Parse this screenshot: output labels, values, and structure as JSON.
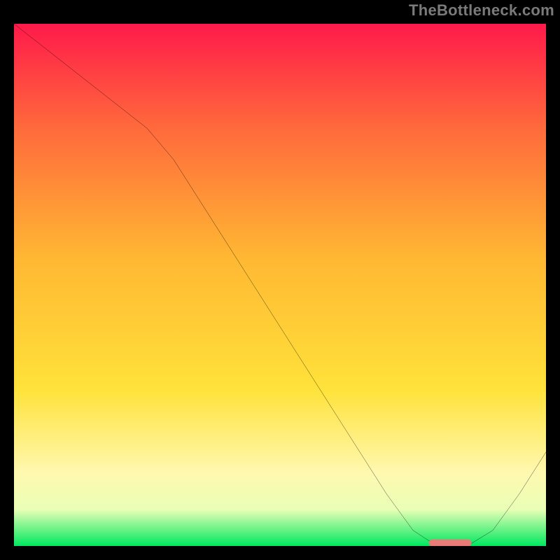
{
  "watermark": "TheBottleneck.com",
  "chart_data": {
    "type": "line",
    "title": "",
    "xlabel": "",
    "ylabel": "",
    "xlim": [
      0,
      100
    ],
    "ylim": [
      0,
      100
    ],
    "grid": false,
    "background_gradient": [
      "#ff1a4a",
      "#ff6a3c",
      "#ffb833",
      "#ffe23a",
      "#fff8b0",
      "#e9ffb5",
      "#00e860"
    ],
    "series": [
      {
        "name": "bottleneck-curve",
        "color": "#000000",
        "x": [
          0,
          5,
          10,
          15,
          20,
          25,
          30,
          35,
          40,
          45,
          50,
          55,
          60,
          65,
          70,
          75,
          78,
          80,
          83,
          86,
          90,
          95,
          100
        ],
        "y": [
          100,
          96,
          92,
          88,
          84,
          80,
          74,
          66,
          58,
          50,
          42,
          34,
          26,
          18,
          10,
          3,
          1,
          0.5,
          0.5,
          0.5,
          3,
          10,
          18
        ]
      }
    ],
    "marker": {
      "name": "optimal-zone",
      "color": "#ea7a77",
      "x_start": 78,
      "x_end": 86,
      "y": 0.6
    }
  }
}
